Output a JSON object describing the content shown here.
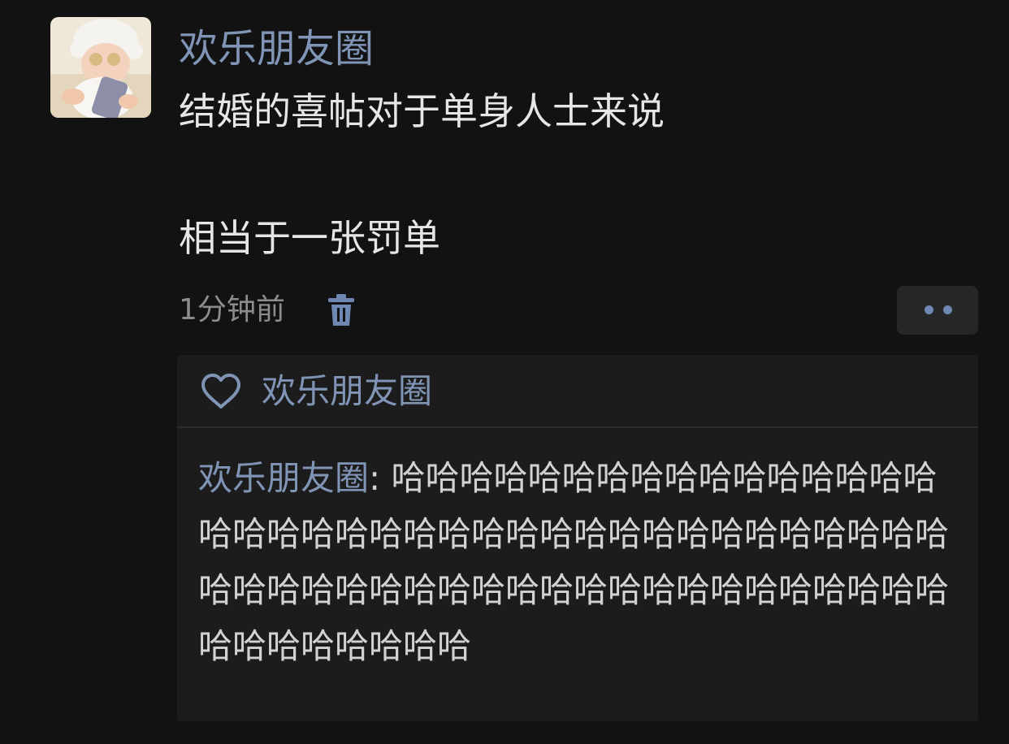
{
  "post": {
    "author": "欢乐朋友圈",
    "text_line1": "结婚的喜帖对于单身人士来说",
    "text_line2": "相当于一张罚单",
    "timestamp": "1分钟前"
  },
  "likes": {
    "names": "欢乐朋友圈"
  },
  "comments": [
    {
      "author": "欢乐朋友圈",
      "separator": ": ",
      "text": "哈哈哈哈哈哈哈哈哈哈哈哈哈哈哈哈哈哈哈哈哈哈哈哈哈哈哈哈哈哈哈哈哈哈哈哈哈哈哈哈哈哈哈哈哈哈哈哈哈哈哈哈哈哈哈哈哈哈哈哈哈哈哈哈哈哈哈哈"
    }
  ],
  "icons": {
    "delete": "trash-icon",
    "like": "heart-icon",
    "more": "more-dots-icon"
  },
  "colors": {
    "background": "#121212",
    "panel": "#1c1c1c",
    "name": "#8094b6",
    "text": "#e6e6e6",
    "meta": "#8c8c8c",
    "accent": "#6f87b3"
  }
}
